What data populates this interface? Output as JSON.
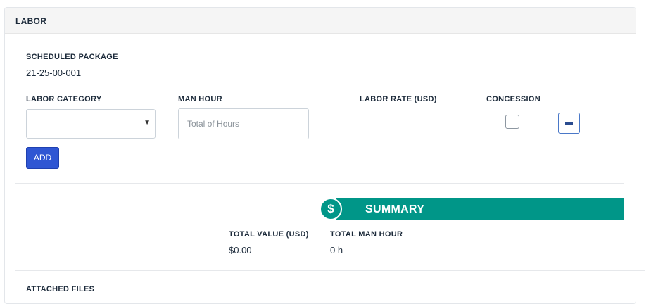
{
  "section": {
    "title": "LABOR"
  },
  "scheduled_package": {
    "label": "SCHEDULED PACKAGE",
    "value": "21-25-00-001"
  },
  "form": {
    "labor_category_label": "LABOR CATEGORY",
    "labor_category_value": "",
    "man_hour_label": "MAN HOUR",
    "man_hour_placeholder": "Total of Hours",
    "labor_rate_label": "LABOR RATE (USD)",
    "concession_label": "CONCESSION",
    "concession_checked": false,
    "add_label": "ADD",
    "remove_icon": "minus-icon"
  },
  "summary": {
    "title": "SUMMARY",
    "icon": "dollar-icon",
    "icon_glyph": "$",
    "accent_color": "#009688",
    "total_value_label": "TOTAL VALUE (USD)",
    "total_value": "$0.00",
    "total_man_hour_label": "TOTAL MAN HOUR",
    "total_man_hour": "0 h"
  },
  "next_section": {
    "title": "ATTACHED FILES"
  }
}
